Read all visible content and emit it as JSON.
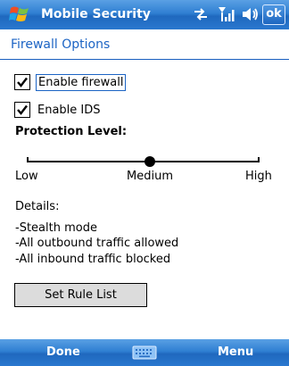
{
  "titlebar": {
    "app_title": "Mobile Security",
    "ok_label": "ok"
  },
  "header": {
    "title": "Firewall Options"
  },
  "options": {
    "enable_firewall": {
      "label": "Enable firewall",
      "checked": true
    },
    "enable_ids": {
      "label": "Enable IDS",
      "checked": true
    }
  },
  "protection": {
    "label": "Protection Level:",
    "levels": [
      "Low",
      "Medium",
      "High"
    ],
    "selected": "Medium"
  },
  "details": {
    "label": "Details:",
    "lines": [
      "-Stealth mode",
      "-All outbound traffic allowed",
      "-All inbound traffic blocked"
    ]
  },
  "rule_button_label": "Set Rule List",
  "softkeys": {
    "left": "Done",
    "right": "Menu"
  },
  "colors": {
    "accent": "#1c64c4",
    "bar_top": "#5aa0e4",
    "bar_bottom": "#1f68be"
  },
  "icons": {
    "logo": "windows-flag-icon",
    "connectivity": "connection-arrows-icon",
    "signal": "signal-strength-icon",
    "volume": "volume-icon",
    "keyboard": "keyboard-icon"
  }
}
